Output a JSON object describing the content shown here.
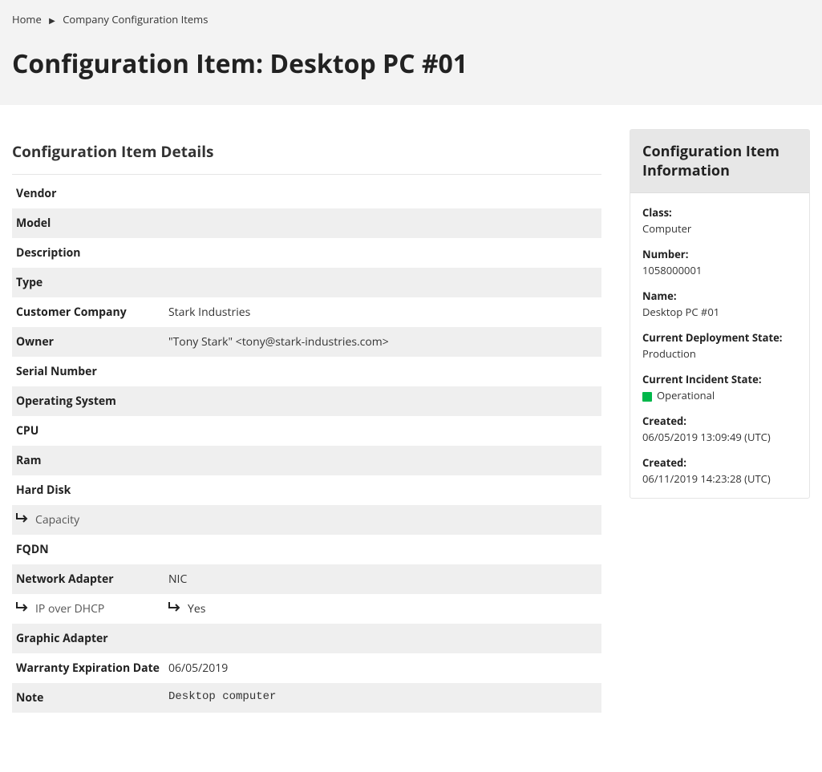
{
  "breadcrumb": {
    "home": "Home",
    "current": "Company Configuration Items"
  },
  "page_title": "Configuration Item: Desktop PC #01",
  "details_heading": "Configuration Item Details",
  "details": {
    "vendor_label": "Vendor",
    "vendor_value": "",
    "model_label": "Model",
    "model_value": "",
    "description_label": "Description",
    "description_value": "",
    "type_label": "Type",
    "type_value": "",
    "customer_company_label": "Customer Company",
    "customer_company_value": "Stark Industries",
    "owner_label": "Owner",
    "owner_value": "\"Tony Stark\" <tony@stark-industries.com>",
    "serial_label": "Serial Number",
    "serial_value": "",
    "os_label": "Operating System",
    "os_value": "",
    "cpu_label": "CPU",
    "cpu_value": "",
    "ram_label": "Ram",
    "ram_value": "",
    "hdd_label": "Hard Disk",
    "hdd_value": "",
    "capacity_label": "Capacity",
    "capacity_value": "",
    "fqdn_label": "FQDN",
    "fqdn_value": "",
    "nic_label": "Network Adapter",
    "nic_value": "NIC",
    "dhcp_label": "IP over DHCP",
    "dhcp_value": "Yes",
    "gpu_label": "Graphic Adapter",
    "gpu_value": "",
    "warranty_label": "Warranty Expiration Date",
    "warranty_value": "06/05/2019",
    "note_label": "Note",
    "note_value": "Desktop computer"
  },
  "info_heading": "Configuration Item Information",
  "info": {
    "class_label": "Class:",
    "class_value": "Computer",
    "number_label": "Number:",
    "number_value": "1058000001",
    "name_label": "Name:",
    "name_value": "Desktop PC #01",
    "deploy_label": "Current Deployment State:",
    "deploy_value": "Production",
    "incident_label": "Current Incident State:",
    "incident_value": "Operational",
    "incident_color": "#00b74a",
    "created_label": "Created:",
    "created_value": "06/05/2019 13:09:49 (UTC)",
    "updated_label": "Created:",
    "updated_value": "06/11/2019 14:23:28 (UTC)"
  }
}
